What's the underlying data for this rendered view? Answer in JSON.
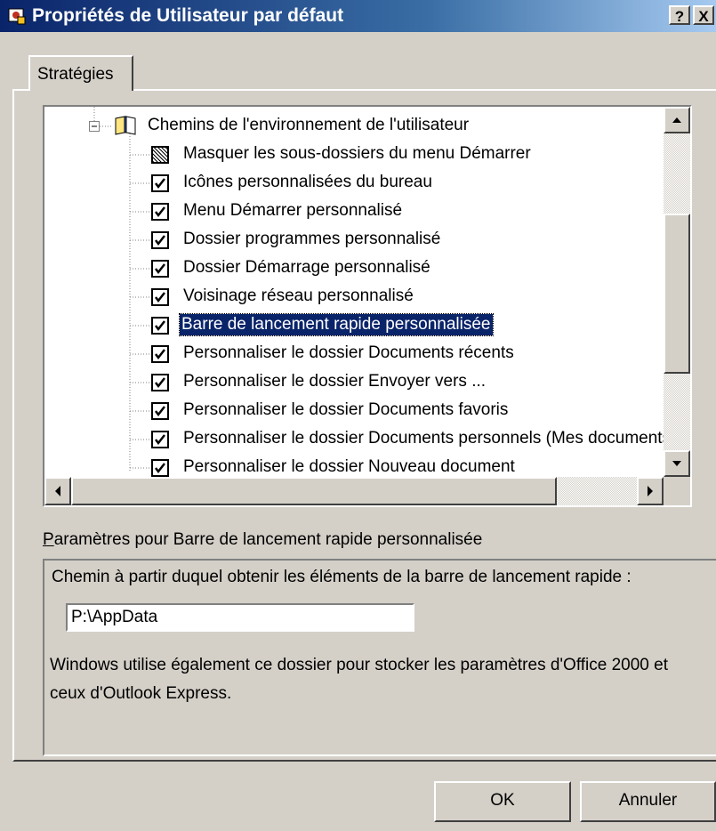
{
  "window": {
    "title": "Propriétés de Utilisateur par défaut",
    "help_button": "?",
    "close_button": "X"
  },
  "tabs": [
    {
      "label": "Stratégies",
      "selected": true
    }
  ],
  "tree": {
    "parent": {
      "label": "Chemins de l'environnement de l'utilisateur",
      "expanded": true,
      "icon": "book-icon"
    },
    "items": [
      {
        "label": "Masquer les sous-dossiers du menu Démarrer",
        "state": "indeterminate"
      },
      {
        "label": "Icônes personnalisées du bureau",
        "state": "checked"
      },
      {
        "label": "Menu Démarrer personnalisé",
        "state": "checked"
      },
      {
        "label": "Dossier programmes personnalisé",
        "state": "checked"
      },
      {
        "label": "Dossier Démarrage personnalisé",
        "state": "checked"
      },
      {
        "label": "Voisinage réseau personnalisé",
        "state": "checked"
      },
      {
        "label": "Barre de lancement rapide personnalisée",
        "state": "checked",
        "selected": true
      },
      {
        "label": "Personnaliser le dossier Documents récents",
        "state": "checked"
      },
      {
        "label": "Personnaliser le dossier Envoyer vers ...",
        "state": "checked"
      },
      {
        "label": "Personnaliser le dossier Documents favoris",
        "state": "checked"
      },
      {
        "label": "Personnaliser le dossier Documents personnels (Mes documents)",
        "state": "checked"
      },
      {
        "label": "Personnaliser le dossier Nouveau document",
        "state": "checked"
      }
    ]
  },
  "params": {
    "label_underlined": "P",
    "label_rest": "aramètres pour Barre de lancement rapide personnalisée",
    "path_prompt": "Chemin à partir duquel obtenir les éléments de la barre de lancement rapide :",
    "path_value": "P:\\AppData",
    "note": "Windows utilise également ce dossier pour stocker les paramètres d'Office 2000 et ceux d'Outlook Express."
  },
  "buttons": {
    "ok": "OK",
    "cancel": "Annuler"
  }
}
